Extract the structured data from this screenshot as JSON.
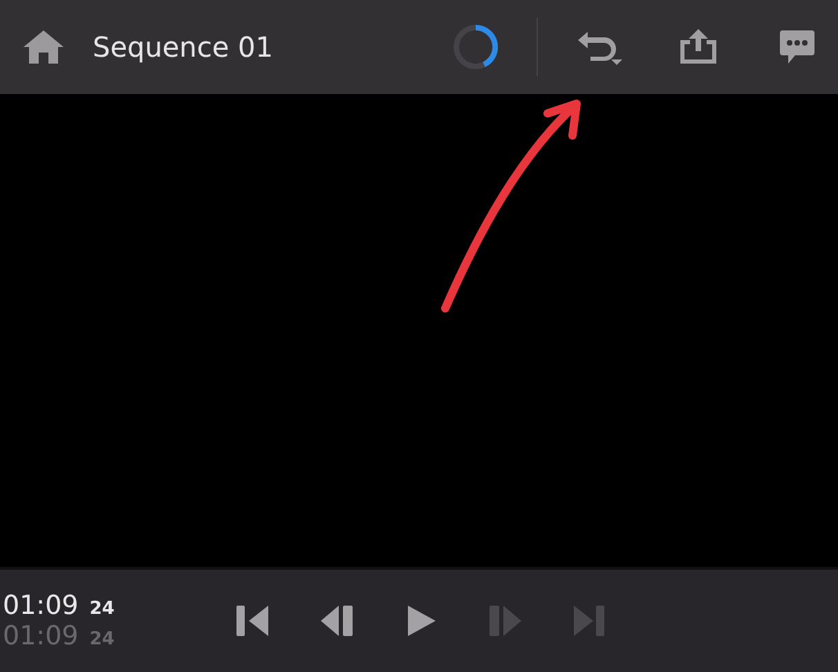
{
  "header": {
    "title": "Sequence 01"
  },
  "timecodes": [
    {
      "time": "01:09",
      "frames": "24",
      "dim": false
    },
    {
      "time": "01:09",
      "frames": "24",
      "dim": true
    }
  ],
  "transport": [
    {
      "kind": "start",
      "disabled": false
    },
    {
      "kind": "back",
      "disabled": false
    },
    {
      "kind": "play",
      "disabled": false
    },
    {
      "kind": "forward",
      "disabled": true
    },
    {
      "kind": "end",
      "disabled": true
    }
  ]
}
